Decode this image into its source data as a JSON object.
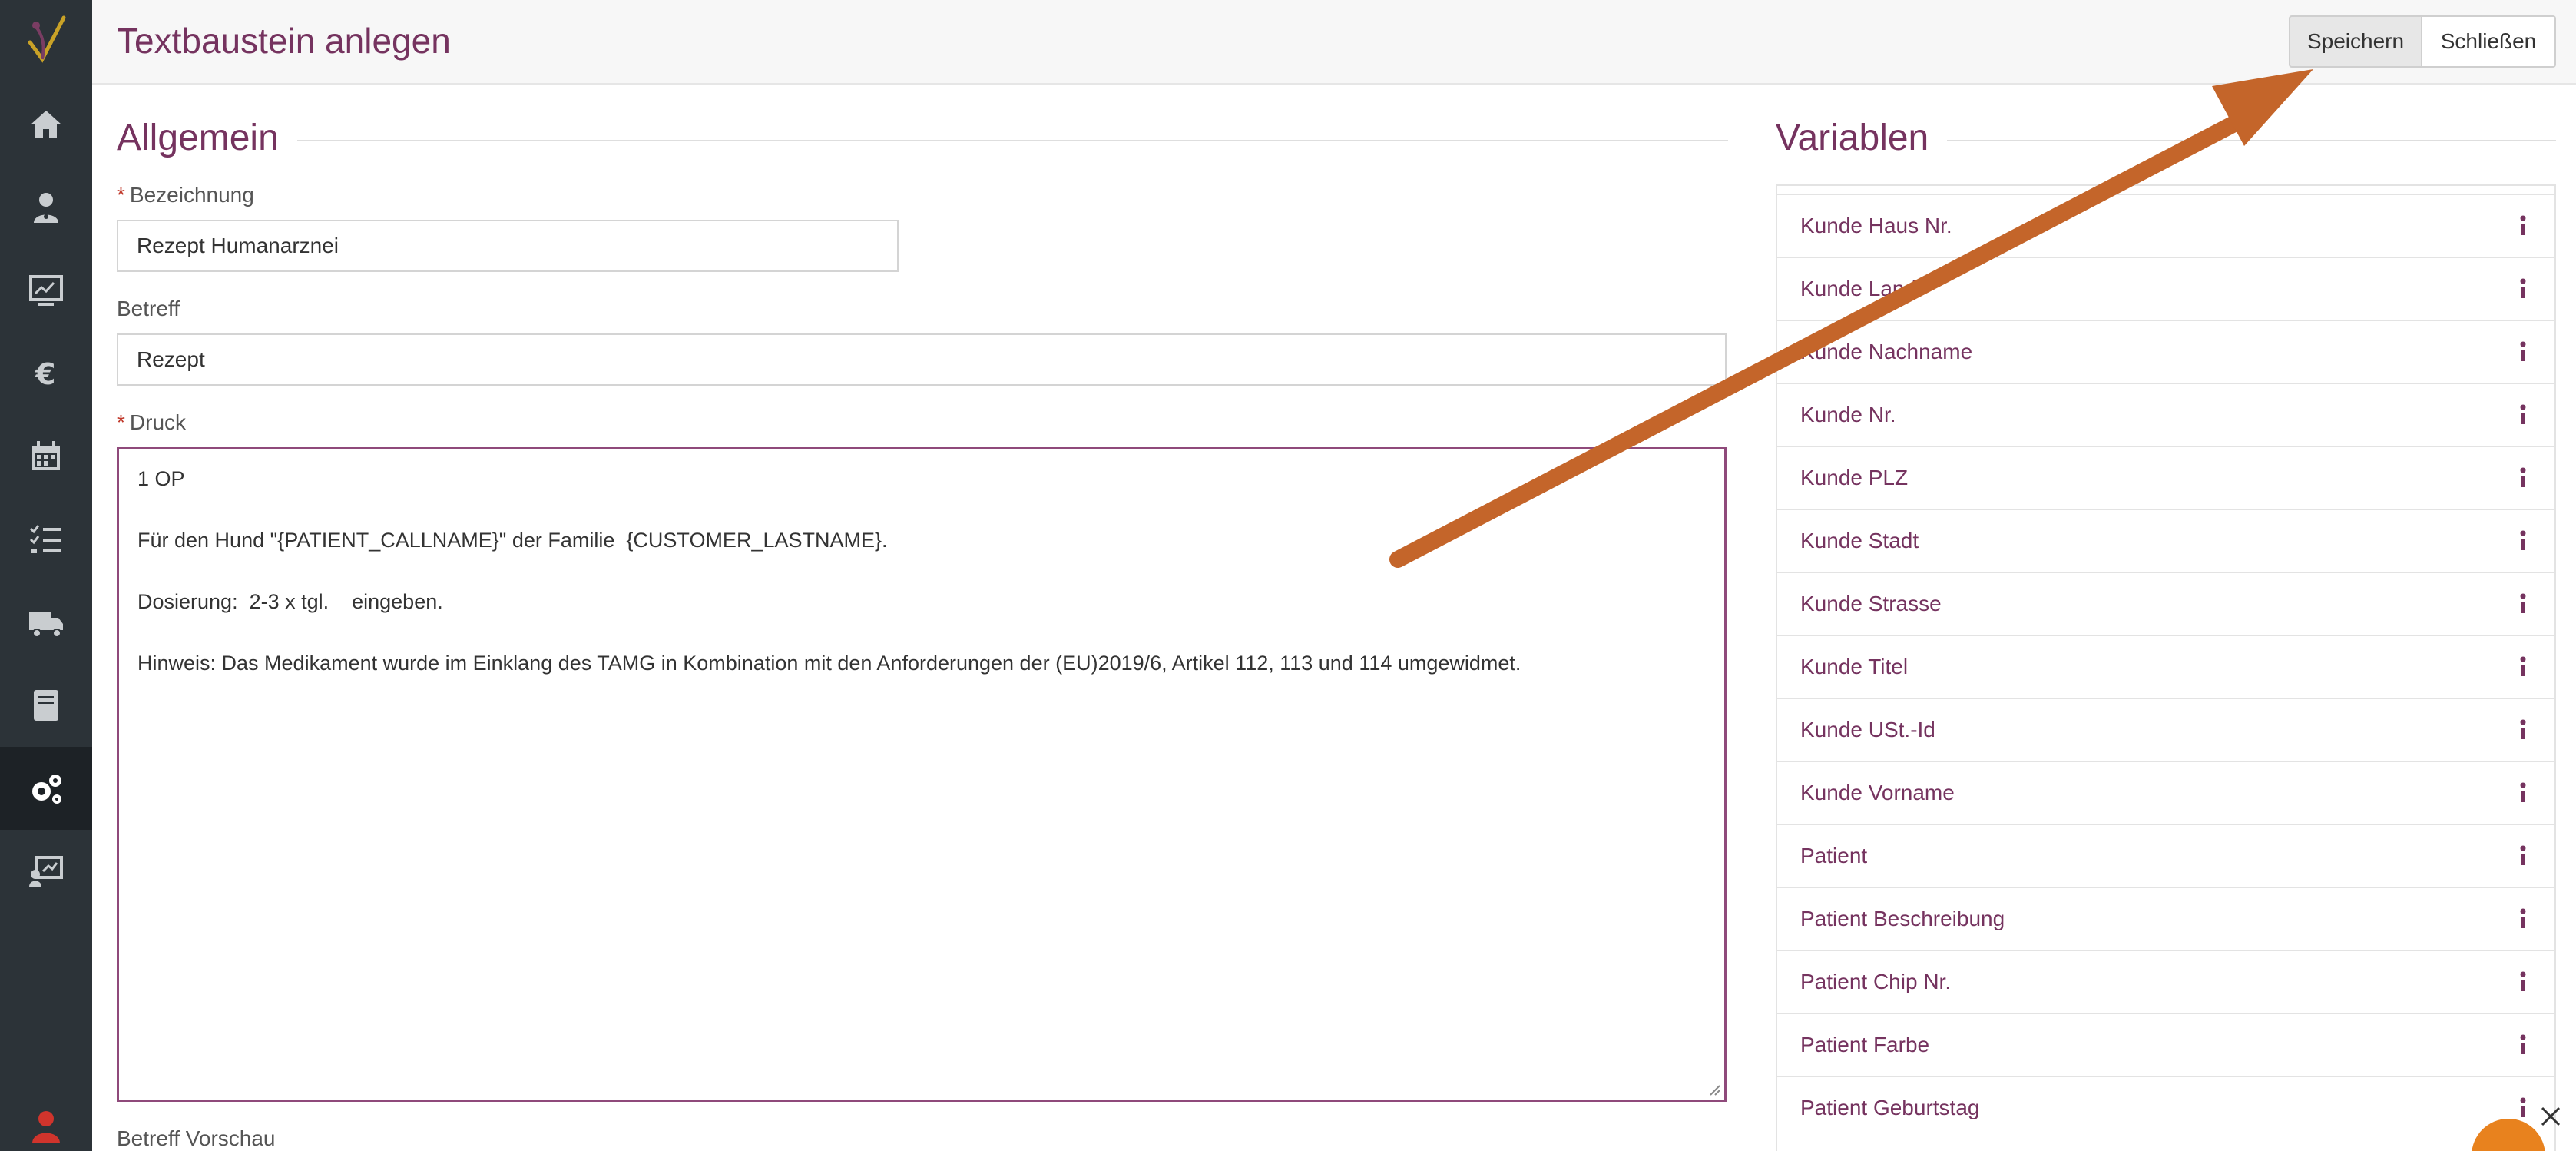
{
  "header": {
    "title": "Textbaustein anlegen",
    "save_label": "Speichern",
    "close_label": "Schließen"
  },
  "sidebar": {
    "items": [
      {
        "icon": "home-icon"
      },
      {
        "icon": "doctor-icon"
      },
      {
        "icon": "monitor-chart-icon"
      },
      {
        "icon": "euro-icon"
      },
      {
        "icon": "calendar-icon"
      },
      {
        "icon": "checklist-icon"
      },
      {
        "icon": "truck-icon"
      },
      {
        "icon": "book-icon"
      },
      {
        "icon": "gears-icon",
        "active": true
      },
      {
        "icon": "presentation-icon"
      }
    ]
  },
  "general": {
    "section_title": "Allgemein",
    "bezeichnung_label": "Bezeichnung",
    "bezeichnung_value": "Rezept Humanarznei",
    "betreff_label": "Betreff",
    "betreff_value": "Rezept",
    "druck_label": "Druck",
    "druck_lines": [
      "1 OP",
      "",
      "Für den Hund \"{PATIENT_CALLNAME}\" der Familie  {CUSTOMER_LASTNAME}.",
      "",
      "Dosierung:  2-3 x tgl.    eingeben.",
      "",
      "Hinweis: Das Medikament wurde im Einklang des TAMG in Kombination mit den Anforderungen der (EU)2019/6, Artikel 112, 113 und 114 umgewidmet."
    ],
    "betreff_vorschau_label": "Betreff Vorschau"
  },
  "variables": {
    "section_title": "Variablen",
    "items": [
      "Kunde Haus Nr.",
      "Kunde Land",
      "Kunde Nachname",
      "Kunde Nr.",
      "Kunde PLZ",
      "Kunde Stadt",
      "Kunde Strasse",
      "Kunde Titel",
      "Kunde USt.-Id",
      "Kunde Vorname",
      "Patient",
      "Patient Beschreibung",
      "Patient Chip Nr.",
      "Patient Farbe",
      "Patient Geburtstag"
    ]
  },
  "colors": {
    "accent": "#75335f",
    "sidebar": "#2c3338",
    "annotation_arrow": "#c4652a"
  }
}
